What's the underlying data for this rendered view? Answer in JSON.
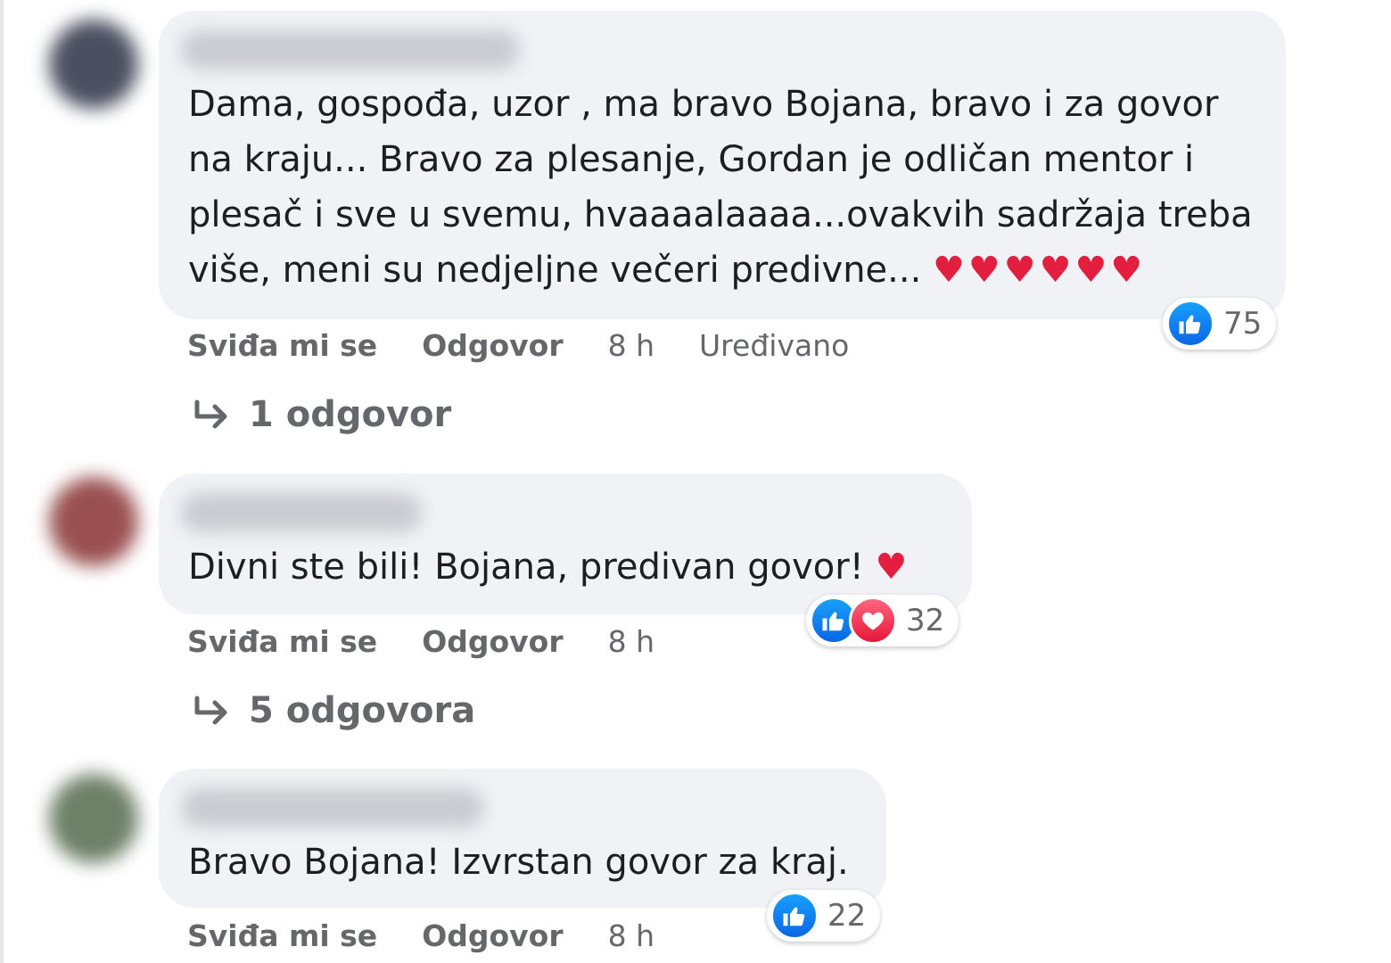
{
  "comments": [
    {
      "text": "Dama, gospođa, uzor , ma bravo Bojana, bravo i za govor\nna kraju... Bravo za plesanje, Gordan je odličan mentor i\nplesač i sve u svemu, hvaaaalaaaa...ovakvih sadržaja treba\nviše, meni su nedjeljne večeri predivne... ",
      "emoji": "♥♥♥♥♥♥",
      "reactions": [
        "like-icon"
      ],
      "reaction_count": "75",
      "like_label": "Sviđa mi se",
      "reply_label": "Odgovor",
      "time": "8 h",
      "edited": "Uređivano",
      "replies_label": "1 odgovor",
      "avatar_color": "#4a5060"
    },
    {
      "text": "Divni ste bili! Bojana, predivan govor! ",
      "emoji": "♥",
      "reactions": [
        "like-icon",
        "love-icon"
      ],
      "reaction_count": "32",
      "like_label": "Sviđa mi se",
      "reply_label": "Odgovor",
      "time": "8 h",
      "replies_label": "5 odgovora",
      "avatar_color": "#9a5050"
    },
    {
      "text": "Bravo Bojana! Izvrstan govor za kraj.",
      "reactions": [
        "like-icon"
      ],
      "reaction_count": "22",
      "like_label": "Sviđa mi se",
      "reply_label": "Odgovor",
      "time": "8 h",
      "avatar_color": "#6e8068"
    }
  ],
  "colors": {
    "bubble": "#f0f2f5",
    "text": "#1c1e21",
    "muted": "#65676b",
    "like_blue": "#0a66e4",
    "love_red": "#e41e3f"
  }
}
